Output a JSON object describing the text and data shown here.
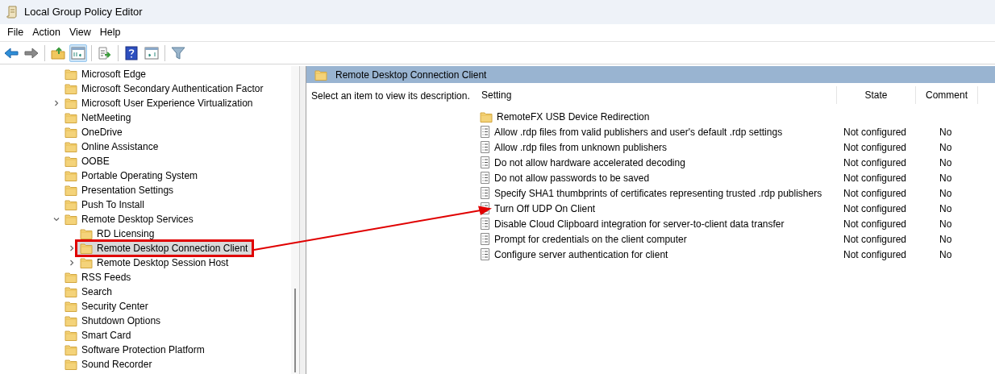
{
  "window": {
    "title": "Local Group Policy Editor"
  },
  "menu": [
    "File",
    "Action",
    "View",
    "Help"
  ],
  "toolbar": [
    {
      "kind": "back",
      "pressed": false
    },
    {
      "kind": "forward",
      "pressed": false
    },
    {
      "kind": "sep"
    },
    {
      "kind": "up",
      "pressed": false
    },
    {
      "kind": "tree",
      "pressed": true
    },
    {
      "kind": "sep"
    },
    {
      "kind": "export",
      "pressed": false
    },
    {
      "kind": "sep"
    },
    {
      "kind": "help",
      "pressed": false
    },
    {
      "kind": "pane",
      "pressed": false
    },
    {
      "kind": "sep"
    },
    {
      "kind": "filter",
      "pressed": false
    }
  ],
  "tree": [
    {
      "label": "Microsoft Edge",
      "selected": false,
      "annotated": false
    },
    {
      "label": "Microsoft Secondary Authentication Factor",
      "selected": false,
      "annotated": false
    },
    {
      "label": "Microsoft User Experience Virtualization",
      "expanded": false,
      "selected": false,
      "annotated": false
    },
    {
      "label": "NetMeeting",
      "selected": false,
      "annotated": false
    },
    {
      "label": "OneDrive",
      "selected": false,
      "annotated": false
    },
    {
      "label": "Online Assistance",
      "selected": false,
      "annotated": false
    },
    {
      "label": "OOBE",
      "selected": false,
      "annotated": false
    },
    {
      "label": "Portable Operating System",
      "selected": false,
      "annotated": false
    },
    {
      "label": "Presentation Settings",
      "selected": false,
      "annotated": false
    },
    {
      "label": "Push To Install",
      "selected": false,
      "annotated": false
    },
    {
      "label": "Remote Desktop Services",
      "expanded": true,
      "selected": false,
      "annotated": false,
      "children": [
        {
          "label": "RD Licensing",
          "selected": false,
          "annotated": false
        },
        {
          "label": "Remote Desktop Connection Client",
          "expanded": false,
          "selected": true,
          "annotated": true
        },
        {
          "label": "Remote Desktop Session Host",
          "expanded": false,
          "selected": false,
          "annotated": false
        }
      ]
    },
    {
      "label": "RSS Feeds",
      "selected": false,
      "annotated": false
    },
    {
      "label": "Search",
      "selected": false,
      "annotated": false
    },
    {
      "label": "Security Center",
      "selected": false,
      "annotated": false
    },
    {
      "label": "Shutdown Options",
      "selected": false,
      "annotated": false
    },
    {
      "label": "Smart Card",
      "selected": false,
      "annotated": false
    },
    {
      "label": "Software Protection Platform",
      "selected": false,
      "annotated": false
    },
    {
      "label": "Sound Recorder",
      "selected": false,
      "annotated": false
    }
  ],
  "panel": {
    "title": "Remote Desktop Connection Client",
    "description": "Select an item to view its description."
  },
  "table": {
    "columns": [
      "Setting",
      "State",
      "Comment"
    ],
    "rows": [
      {
        "kind": "folder",
        "setting": "RemoteFX USB Device Redirection"
      },
      {
        "kind": "policy",
        "setting": "Allow .rdp files from valid publishers and user's default .rdp settings",
        "state": "Not configured",
        "comment": "No"
      },
      {
        "kind": "policy",
        "setting": "Allow .rdp files from unknown publishers",
        "state": "Not configured",
        "comment": "No"
      },
      {
        "kind": "policy",
        "setting": "Do not allow hardware accelerated decoding",
        "state": "Not configured",
        "comment": "No"
      },
      {
        "kind": "policy",
        "setting": "Do not allow passwords to be saved",
        "state": "Not configured",
        "comment": "No"
      },
      {
        "kind": "policy",
        "setting": "Specify SHA1 thumbprints of certificates representing trusted .rdp publishers",
        "state": "Not configured",
        "comment": "No"
      },
      {
        "kind": "policy",
        "setting": "Turn Off UDP On Client",
        "state": "Not configured",
        "comment": "No"
      },
      {
        "kind": "policy",
        "setting": "Disable Cloud Clipboard integration for server-to-client data transfer",
        "state": "Not configured",
        "comment": "No"
      },
      {
        "kind": "policy",
        "setting": "Prompt for credentials on the client computer",
        "state": "Not configured",
        "comment": "No"
      },
      {
        "kind": "policy",
        "setting": "Configure server authentication for client",
        "state": "Not configured",
        "comment": "No"
      }
    ]
  }
}
